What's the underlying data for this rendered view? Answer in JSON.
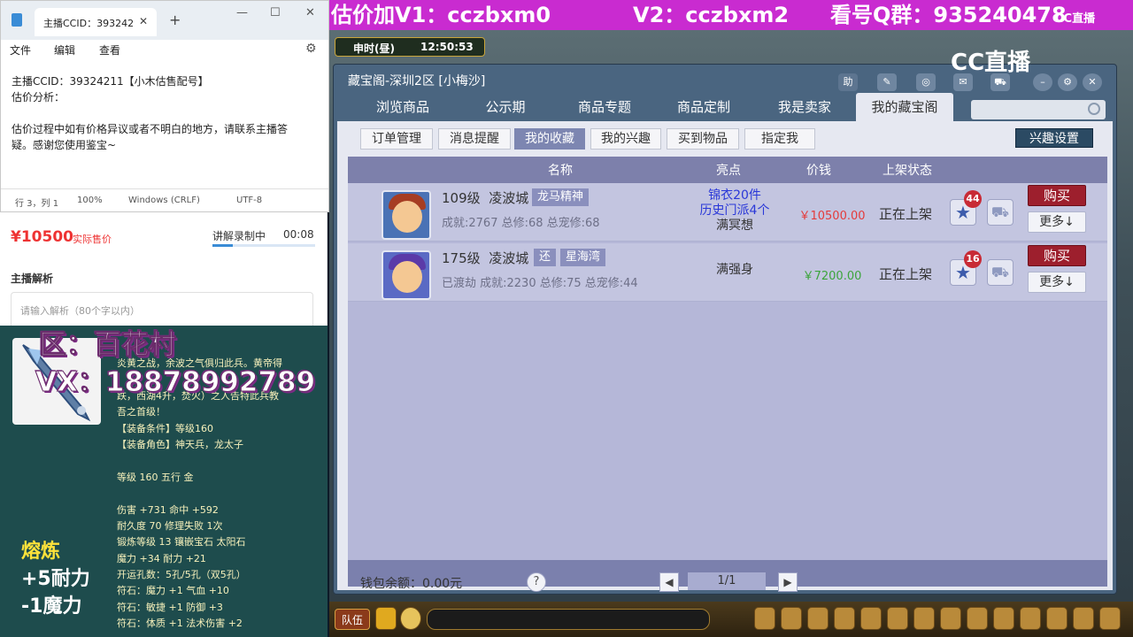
{
  "notepad": {
    "tab_title": "主播CCID：393242",
    "menu": [
      "文件",
      "编辑",
      "查看"
    ],
    "lines": [
      "主播CCID：39324211【小木估售配号】",
      "估价分析：",
      "",
      "估价过程中如有价格异议或者不明白的地方，请联系主播答",
      "疑。感谢您使用鉴宝~"
    ],
    "status": {
      "position": "行 3，列 1",
      "zoom": "100%",
      "eol": "Windows (CRLF)",
      "encoding": "UTF-8"
    }
  },
  "valuation": {
    "price": "¥10500",
    "price_label": "实际售价",
    "record_status": "讲解录制中",
    "record_time": "00:08",
    "record_progress": 0.2,
    "analysis_title": "主播解析",
    "analysis_placeholder": "请输入解析（80个字以内）"
  },
  "card_overlay": {
    "zone": "区：百花村",
    "vx": "VX：18878992789",
    "lines": [
      "炎黄之战，余波之气俱归此兵。黄帝得",
      "",
      "跌，西湖4升，焚火）之人告特此兵教",
      "吾之首级！",
      "【装备条件】等级160",
      "【装备角色】神天兵，龙太子",
      "",
      "等级 160 五行 金",
      "",
      "伤害 +731 命中 +592",
      "耐久度 70 修理失败 1次",
      "锻炼等级 13 镶嵌宝石 太阳石",
      "魔力 +34 耐力 +21",
      "开运孔数：5孔/5孔（双5孔）",
      "符石：魔力 +1 气血 +10",
      "符石：敏捷 +1 防御 +3",
      "符石：体质 +1 法术伤害 +2"
    ],
    "smelt_title": "熔炼",
    "smelt_lines": [
      "+5耐力",
      "-1魔力"
    ]
  },
  "game": {
    "banner": {
      "v1": "估价加V1：cczbxm0",
      "v2": "V2：cczbxm2",
      "qq": "看号Q群：935240478"
    },
    "time_label": "申时(昼)",
    "time": "12:50:53",
    "cc_logo": "CC直播",
    "cc_mini": "CC直播",
    "colors": {
      "banner_bg": "#c92bd0",
      "buy_bg": "#9d1f2d",
      "price_red": "#e43b3b",
      "price_green": "#3ca43c",
      "highlight_blue": "#2a38d8"
    }
  },
  "treasure": {
    "title": "藏宝阁-深圳2区 [小梅沙]",
    "title_icons": [
      "助",
      "pen-icon",
      "gear-icon",
      "chat-icon",
      "cart-icon",
      "minimize-icon",
      "settings-icon",
      "close-icon"
    ],
    "help_icon_label": "助",
    "tabs": [
      "浏览商品",
      "公示期",
      "商品专题",
      "商品定制",
      "我是卖家",
      "我的藏宝阁"
    ],
    "active_tab": "我的藏宝阁",
    "subtabs": [
      "订单管理",
      "消息提醒",
      "我的收藏",
      "我的兴趣",
      "买到物品",
      "指定我"
    ],
    "active_subtab": "我的收藏",
    "interest_button": "兴趣设置",
    "columns": [
      "名称",
      "亮点",
      "价钱",
      "上架状态"
    ],
    "items": [
      {
        "level": "109级",
        "server": "凌波城",
        "tags": [
          "龙马精神"
        ],
        "stats": "成就:2767 总修:68 总宠修:68",
        "highlights": [
          "锦衣20件",
          "历史门派4个",
          "满冥想"
        ],
        "price": "￥10500.00",
        "status": "正在上架",
        "favorites": "44",
        "buy": "购买",
        "more": "更多↓"
      },
      {
        "level": "175级",
        "server": "凌波城",
        "tags": [
          "还",
          "星海湾"
        ],
        "stats": "已渡劫 成就:2230 总修:75 总宠修:44",
        "highlights": [
          "满强身"
        ],
        "price": "￥7200.00",
        "status": "正在上架",
        "favorites": "16",
        "buy": "购买",
        "more": "更多↓"
      }
    ],
    "wallet": "钱包余额：0.00元",
    "help": "?",
    "page": "1/1"
  },
  "gamebar": {
    "team": "队伍"
  }
}
